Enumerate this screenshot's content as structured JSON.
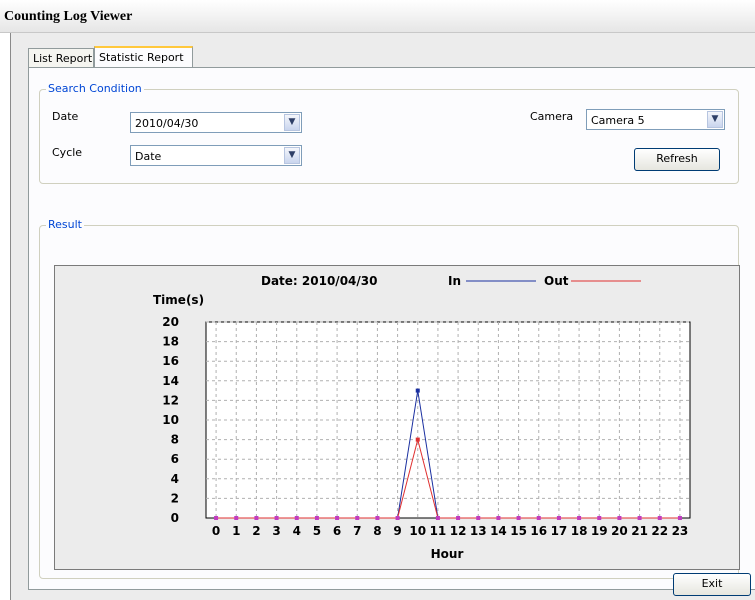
{
  "window": {
    "title": "Counting Log Viewer"
  },
  "tabs": [
    {
      "label": "List Report",
      "active": false
    },
    {
      "label": "Statistic Report",
      "active": true
    }
  ],
  "search": {
    "group_label": "Search Condition",
    "date_label": "Date",
    "date_value": "2010/04/30",
    "cycle_label": "Cycle",
    "cycle_value": "Date",
    "camera_label": "Camera",
    "camera_value": "Camera 5",
    "refresh_label": "Refresh"
  },
  "result": {
    "group_label": "Result"
  },
  "exit_label": "Exit",
  "chart_data": {
    "type": "line",
    "title": "Date: 2010/04/30",
    "xlabel": "Hour",
    "ylabel": "Time(s)",
    "ylim": [
      0,
      20
    ],
    "yticks": [
      0,
      2,
      4,
      6,
      8,
      10,
      12,
      14,
      16,
      18,
      20
    ],
    "grid": true,
    "legend_position": "top",
    "x": [
      0,
      1,
      2,
      3,
      4,
      5,
      6,
      7,
      8,
      9,
      10,
      11,
      12,
      13,
      14,
      15,
      16,
      17,
      18,
      19,
      20,
      21,
      22,
      23
    ],
    "series": [
      {
        "name": "In",
        "color": "#1a2fa0",
        "values": [
          0,
          0,
          0,
          0,
          0,
          0,
          0,
          0,
          0,
          0,
          13,
          0,
          0,
          0,
          0,
          0,
          0,
          0,
          0,
          0,
          0,
          0,
          0,
          0
        ]
      },
      {
        "name": "Out",
        "color": "#e03030",
        "values": [
          0,
          0,
          0,
          0,
          0,
          0,
          0,
          0,
          0,
          0,
          8,
          0,
          0,
          0,
          0,
          0,
          0,
          0,
          0,
          0,
          0,
          0,
          0,
          0
        ]
      }
    ]
  }
}
